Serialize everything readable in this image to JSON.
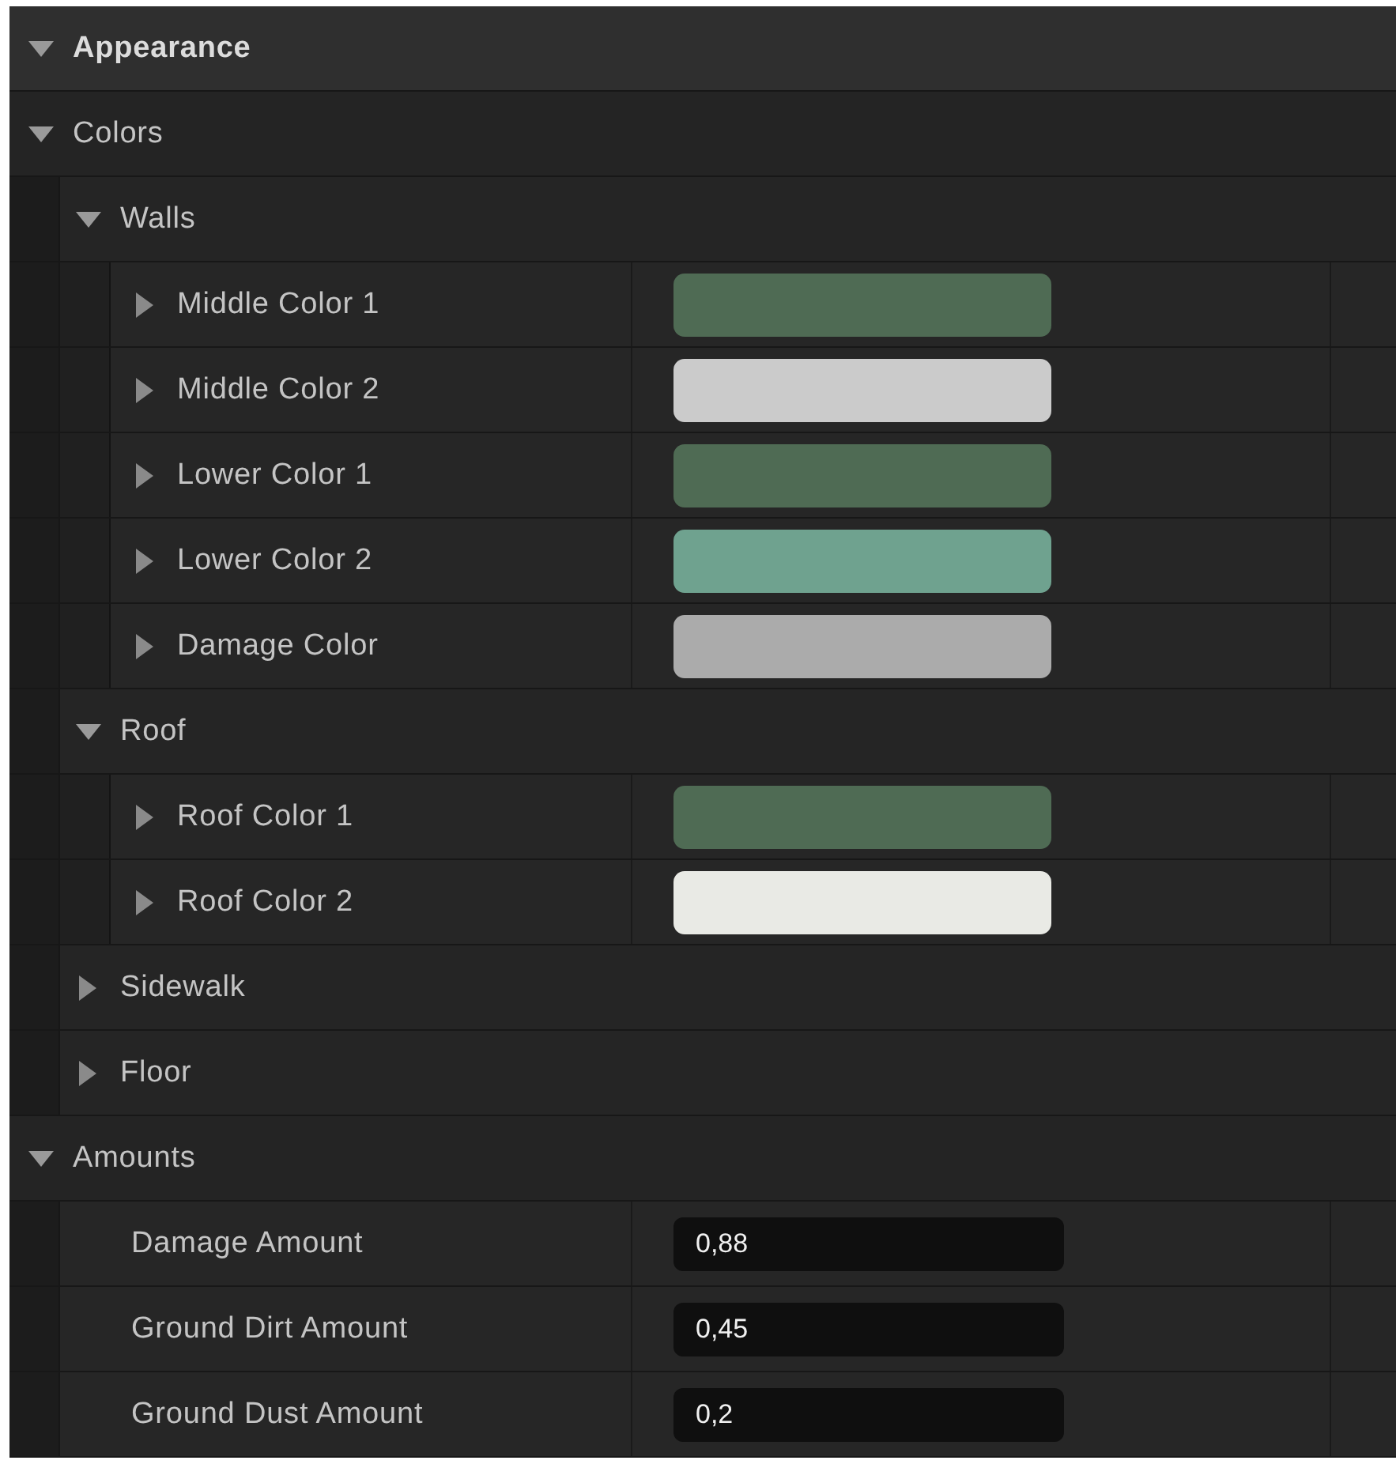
{
  "category": {
    "label": "Appearance",
    "expanded": true,
    "children": [
      {
        "kind": "group",
        "label": "Colors",
        "expanded": true,
        "children": [
          {
            "kind": "group",
            "label": "Walls",
            "expanded": true,
            "children": [
              {
                "kind": "color",
                "label": "Middle Color 1",
                "expanded": false,
                "color": "#4f6b54"
              },
              {
                "kind": "color",
                "label": "Middle Color 2",
                "expanded": false,
                "color": "#cbcbcb"
              },
              {
                "kind": "color",
                "label": "Lower Color 1",
                "expanded": false,
                "color": "#4f6b54"
              },
              {
                "kind": "color",
                "label": "Lower Color 2",
                "expanded": false,
                "color": "#6fa28f"
              },
              {
                "kind": "color",
                "label": "Damage Color",
                "expanded": false,
                "color": "#ababab"
              }
            ]
          },
          {
            "kind": "group",
            "label": "Roof",
            "expanded": true,
            "children": [
              {
                "kind": "color",
                "label": "Roof Color 1",
                "expanded": false,
                "color": "#4f6b54"
              },
              {
                "kind": "color",
                "label": "Roof Color 2",
                "expanded": false,
                "color": "#e9eae5"
              }
            ]
          },
          {
            "kind": "group",
            "label": "Sidewalk",
            "expanded": false
          },
          {
            "kind": "group",
            "label": "Floor",
            "expanded": false
          }
        ]
      },
      {
        "kind": "group",
        "label": "Amounts",
        "expanded": true,
        "children": [
          {
            "kind": "number",
            "label": "Damage Amount",
            "value": "0,88"
          },
          {
            "kind": "number",
            "label": "Ground Dirt Amount",
            "value": "0,45"
          },
          {
            "kind": "number",
            "label": "Ground Dust Amount",
            "value": "0,2"
          }
        ]
      }
    ]
  }
}
